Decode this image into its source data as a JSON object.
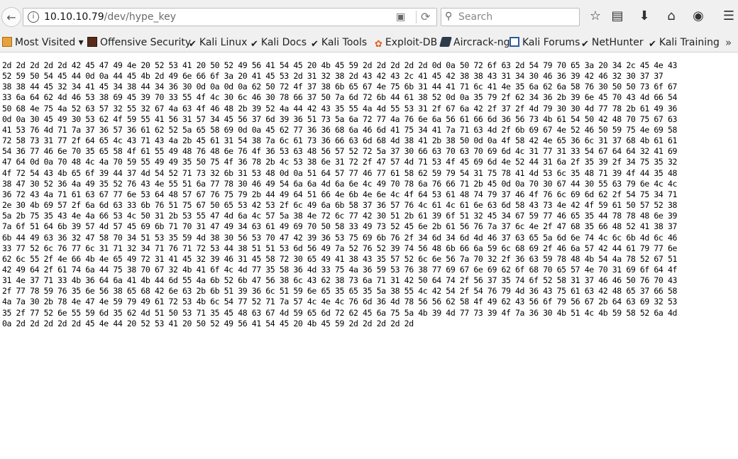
{
  "browser": {
    "url_host": "10.10.10.79",
    "url_path": "/dev/hype_key",
    "search_placeholder": "Search"
  },
  "bookmarks": [
    {
      "label": "Most Visited",
      "icon": "folder-icon"
    },
    {
      "label": "Offensive Security",
      "icon": "offsec-icon"
    },
    {
      "label": "Kali Linux",
      "icon": "kali-dragon-icon"
    },
    {
      "label": "Kali Docs",
      "icon": "kali-dragon-icon"
    },
    {
      "label": "Kali Tools",
      "icon": "kali-dragon-icon"
    },
    {
      "label": "Exploit-DB",
      "icon": "exploit-db-icon"
    },
    {
      "label": "Aircrack-ng",
      "icon": "aircrack-icon"
    },
    {
      "label": "Kali Forums",
      "icon": "forum-icon"
    },
    {
      "label": "NetHunter",
      "icon": "kali-dragon-icon"
    },
    {
      "label": "Kali Training",
      "icon": "kali-dragon-icon"
    }
  ],
  "content": {
    "lines": [
      "2d 2d 2d 2d 2d 42 45 47 49 4e 20 52 53 41 20 50 52 49 56 41 54 45 20 4b 45 59 2d 2d 2d 2d 2d 0d 0a 50 72 6f 63 2d 54 79 70 65 3a 20 34 2c 45 4e 43",
      "52 59 50 54 45 44 0d 0a 44 45 4b 2d 49 6e 66 6f 3a 20 41 45 53 2d 31 32 38 2d 43 42 43 2c 41 45 42 38 38 43 31 34 30 46 36 39 42 46 32 30 37 37",
      "38 38 44 45 32 34 41 45 34 38 44 34 36 30 0d 0a 0d 0a 62 50 72 4f 37 38 6b 65 67 4e 75 6b 31 44 41 71 6c 41 4e 35 6a 62 6a 58 76 30 50 50 73 6f 67",
      "33 6a 64 62 4d 46 53 38 69 45 39 70 33 55 4f 4c 30 6c 46 30 78 66 37 50 7a 6d 72 6b 44 61 38 52 0d 0a 35 79 2f 62 34 36 2b 39 6e 45 70 43 4d 66 54",
      "50 68 4e 75 4a 52 63 57 32 55 32 67 4a 63 4f 46 48 2b 39 52 4a 44 42 43 35 55 4a 4d 55 53 31 2f 67 6a 42 2f 37 2f 4d 79 30 30 4d 77 78 2b 61 49 36",
      "0d 0a 30 45 49 30 53 62 4f 59 55 41 56 31 57 34 45 56 37 6d 39 36 51 73 5a 6a 72 77 4a 76 6e 6a 56 61 66 6d 36 56 73 4b 61 54 50 42 48 70 75 67 63",
      "41 53 76 4d 71 7a 37 36 57 36 61 62 52 5a 65 58 69 0d 0a 45 62 77 36 36 68 6a 46 6d 41 75 34 41 7a 71 63 4d 2f 6b 69 67 4e 52 46 50 59 75 4e 69 58",
      "72 58 73 31 77 2f 64 65 4c 43 71 43 4a 2b 45 61 31 54 38 7a 6c 61 73 36 66 63 6d 68 4d 38 41 2b 38 50 0d 0a 4f 58 42 4e 65 36 6c 31 37 68 4b 61 61",
      "54 36 77 46 6e 70 35 65 58 4f 61 55 49 48 76 48 6e 76 4f 36 53 63 48 56 57 52 72 5a 37 30 66 63 70 63 70 69 6d 4c 31 77 31 33 54 67 64 64 32 41 69",
      "47 64 0d 0a 70 48 4c 4a 70 59 55 49 49 35 50 75 4f 36 78 2b 4c 53 38 6e 31 72 2f 47 57 4d 71 53 4f 45 69 6d 4e 52 44 31 6a 2f 35 39 2f 34 75 35 32",
      "4f 72 54 43 4b 65 6f 39 44 37 4d 54 52 71 73 32 6b 31 53 48 0d 0a 51 64 57 77 46 77 61 58 62 59 79 54 31 75 78 41 4d 53 6c 35 48 71 39 4f 44 35 48",
      "38 47 30 52 36 4a 49 35 52 76 43 4e 55 51 6a 77 78 30 46 49 54 6a 6a 4d 6a 6e 4c 49 70 78 6a 76 66 71 2b 45 0d 0a 70 30 67 44 30 55 63 79 6e 4c 4c",
      "36 72 43 4a 71 61 63 67 77 6e 53 64 48 57 67 76 75 79 2b 44 49 64 51 66 4e 6b 4e 6e 4c 4f 64 53 61 48 74 79 37 46 4f 76 6c 69 6d 62 2f 54 75 34 71",
      "2e 30 4b 69 57 2f 6a 6d 63 33 6b 76 51 75 67 50 65 53 42 53 2f 6c 49 6a 6b 58 37 36 57 76 4c 61 4c 61 6e 63 6d 58 43 73 4e 42 4f 59 61 50 57 52 38",
      "5a 2b 75 35 43 4e 4a 66 53 4c 50 31 2b 53 55 47 4d 6a 4c 57 5a 38 4e 72 6c 77 42 30 51 2b 61 39 6f 51 32 45 34 67 59 77 46 65 35 44 78 78 48 6e 39",
      "7a 6f 51 64 6b 39 57 4d 57 45 69 6b 71 70 31 47 49 34 63 61 49 69 70 50 58 33 49 73 52 45 6e 2b 61 56 76 7a 37 6c 4e 2f 47 68 35 66 48 52 41 38 37",
      "6b 44 49 63 36 32 47 58 70 34 51 53 35 59 4d 38 30 56 53 70 47 42 39 36 53 75 69 6b 76 2f 34 6d 34 6d 4d 46 37 63 65 5a 6d 6e 74 4c 6c 6b 4d 6c 46",
      "33 77 52 6c 76 77 6c 31 71 32 34 71 76 71 72 53 44 38 51 51 53 6d 56 49 7a 52 76 52 39 74 56 48 6b 66 6a 59 6c 68 69 2f 46 6a 57 42 44 61 79 77 6e",
      "62 6c 55 2f 4e 66 4b 4e 65 49 72 31 41 45 32 39 46 31 45 58 72 30 65 49 41 38 43 35 57 52 6c 6e 56 7a 70 32 2f 36 63 59 78 48 4b 54 4a 78 52 67 51",
      "42 49 64 2f 61 74 6a 44 75 38 70 67 32 4b 41 6f 4c 4d 77 35 58 36 4d 33 75 4a 36 59 53 76 38 77 69 67 6e 69 62 6f 68 70 65 57 4e 70 31 69 6f 64 4f",
      "31 4e 37 71 33 4b 36 64 6a 41 4b 44 6d 55 4a 6b 52 6b 47 56 38 6c 43 62 38 73 6a 71 31 42 50 64 74 2f 56 37 35 74 6f 52 58 31 37 46 46 50 76 70 43",
      "2f 77 78 59 76 35 6e 56 38 65 68 42 6e 63 2b 6b 51 39 36 6c 51 59 6e 65 35 65 35 5a 38 55 4c 42 54 2f 54 76 79 4d 36 43 75 61 63 42 48 65 37 66 58",
      "4a 7a 30 2b 78 4e 47 4e 59 79 49 61 72 53 4b 6c 54 77 52 71 7a 57 4c 4e 4c 76 6d 36 4d 78 56 56 62 58 4f 49 62 43 56 6f 79 56 67 2b 64 63 69 32 53",
      "35 2f 77 52 6e 55 59 6d 35 62 4d 51 50 53 71 35 45 48 63 67 4d 59 65 6d 72 62 45 6a 75 5a 4b 39 4d 77 73 39 4f 7a 36 30 4b 51 4c 4b 59 58 52 6a 4d"
    ],
    "footer": "0a 2d 2d 2d 2d 2d 45 4e 44 20 52 53 41 20 50 52 49 56 41 54 45 20 4b 45 59 2d 2d 2d 2d 2d"
  }
}
